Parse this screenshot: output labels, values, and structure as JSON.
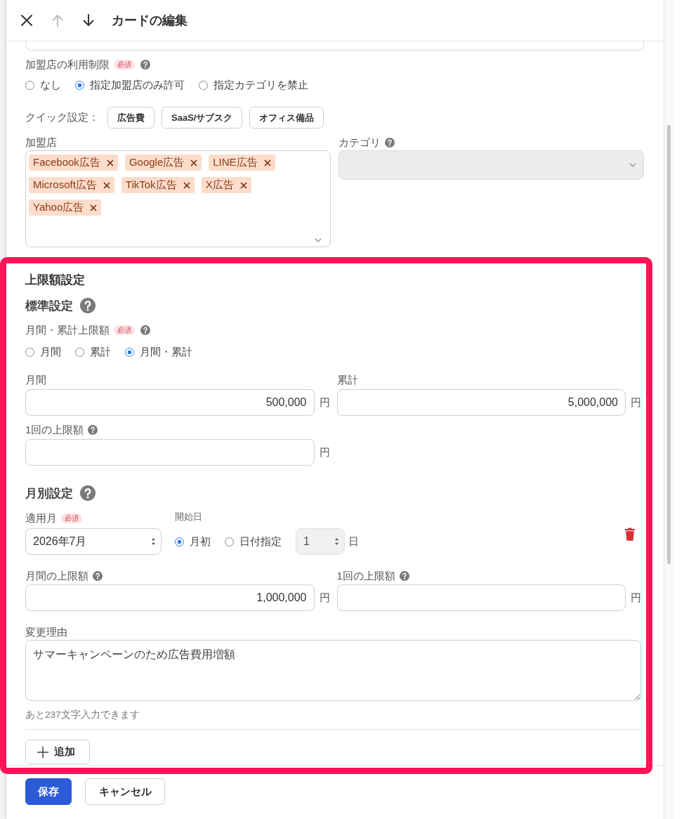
{
  "header": {
    "title": "カードの編集",
    "actions": [
      {
        "kind": "close",
        "disabled": false
      },
      {
        "kind": "up",
        "disabled": true
      },
      {
        "kind": "down",
        "disabled": false
      }
    ]
  },
  "merchant_restriction": {
    "label": "加盟店の利用制限",
    "badge": "必須",
    "options": [
      {
        "label": "なし",
        "selected": false
      },
      {
        "label": "指定加盟店のみ許可",
        "selected": true
      },
      {
        "label": "指定カテゴリを禁止",
        "selected": false
      }
    ]
  },
  "quick_settings": {
    "label": "クイック設定：",
    "buttons": [
      "広告費",
      "SaaS/サブスク",
      "オフィス備品"
    ]
  },
  "merchants": {
    "label": "加盟店",
    "tags": [
      "Facebook広告",
      "Google広告",
      "LINE広告",
      "Microsoft広告",
      "TikTok広告",
      "X広告",
      "Yahoo広告"
    ]
  },
  "category": {
    "label": "カテゴリ",
    "disabled": true
  },
  "limit_settings": {
    "highlighted": true,
    "title": "上限額設定",
    "standard": {
      "title": "標準設定",
      "limit_type": {
        "label": "月間・累計上限額",
        "badge": "必須",
        "options": [
          {
            "label": "月間",
            "selected": false
          },
          {
            "label": "累計",
            "selected": false
          },
          {
            "label": "月間・累計",
            "selected": true
          }
        ]
      },
      "amounts": [
        {
          "label": "月間",
          "value": "500,000",
          "unit": "円"
        },
        {
          "label": "累計",
          "value": "5,000,000",
          "unit": "円"
        }
      ],
      "per_use": {
        "label": "1回の上限額",
        "unit": "円"
      }
    },
    "monthly": {
      "title": "月別設定",
      "entries": [
        {
          "month": {
            "label": "適用月",
            "badge": "必須",
            "value": "2026年7月"
          },
          "start_day": {
            "label": "開始日",
            "options": [
              {
                "label": "月初",
                "selected": true
              },
              {
                "label": "日付指定",
                "selected": false
              }
            ],
            "day": {
              "value": "1",
              "disabled": true
            },
            "unit": "日"
          },
          "amounts": [
            {
              "label": "月間の上限額",
              "value": "1,000,000",
              "unit": "円"
            },
            {
              "label": "1回の上限額",
              "unit": "円"
            }
          ],
          "reason": {
            "label": "変更理由",
            "value": "サマーキャンペーンのため広告費用増額",
            "counter": "あと237文字入力できます"
          }
        }
      ],
      "add_button": "追加"
    }
  },
  "footer": {
    "buttons": [
      {
        "label": "保存",
        "kind": "primary"
      },
      {
        "label": "キャンセル",
        "kind": "secondary"
      }
    ]
  }
}
